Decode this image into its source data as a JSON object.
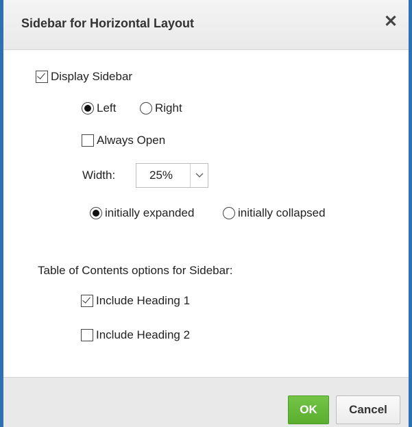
{
  "dialog": {
    "title": "Sidebar for Horizontal Layout",
    "close_icon": "close-icon"
  },
  "sidebar": {
    "display_label": "Display Sidebar",
    "display_checked": true,
    "position_left_label": "Left",
    "position_right_label": "Right",
    "position_selected": "Left",
    "always_open_label": "Always Open",
    "always_open_checked": false,
    "width_label": "Width:",
    "width_value": "25%",
    "initially_expanded_label": "initially expanded",
    "initially_collapsed_label": "initially collapsed",
    "initial_state_selected": "initially expanded"
  },
  "toc": {
    "heading": "Table of Contents options for Sidebar:",
    "heading1_label": "Include Heading 1",
    "heading1_checked": true,
    "heading2_label": "Include Heading 2",
    "heading2_checked": false
  },
  "footer": {
    "ok_label": "OK",
    "cancel_label": "Cancel"
  },
  "colors": {
    "frame_border": "#2f6fb3",
    "ok_button": "#5aae2e"
  }
}
